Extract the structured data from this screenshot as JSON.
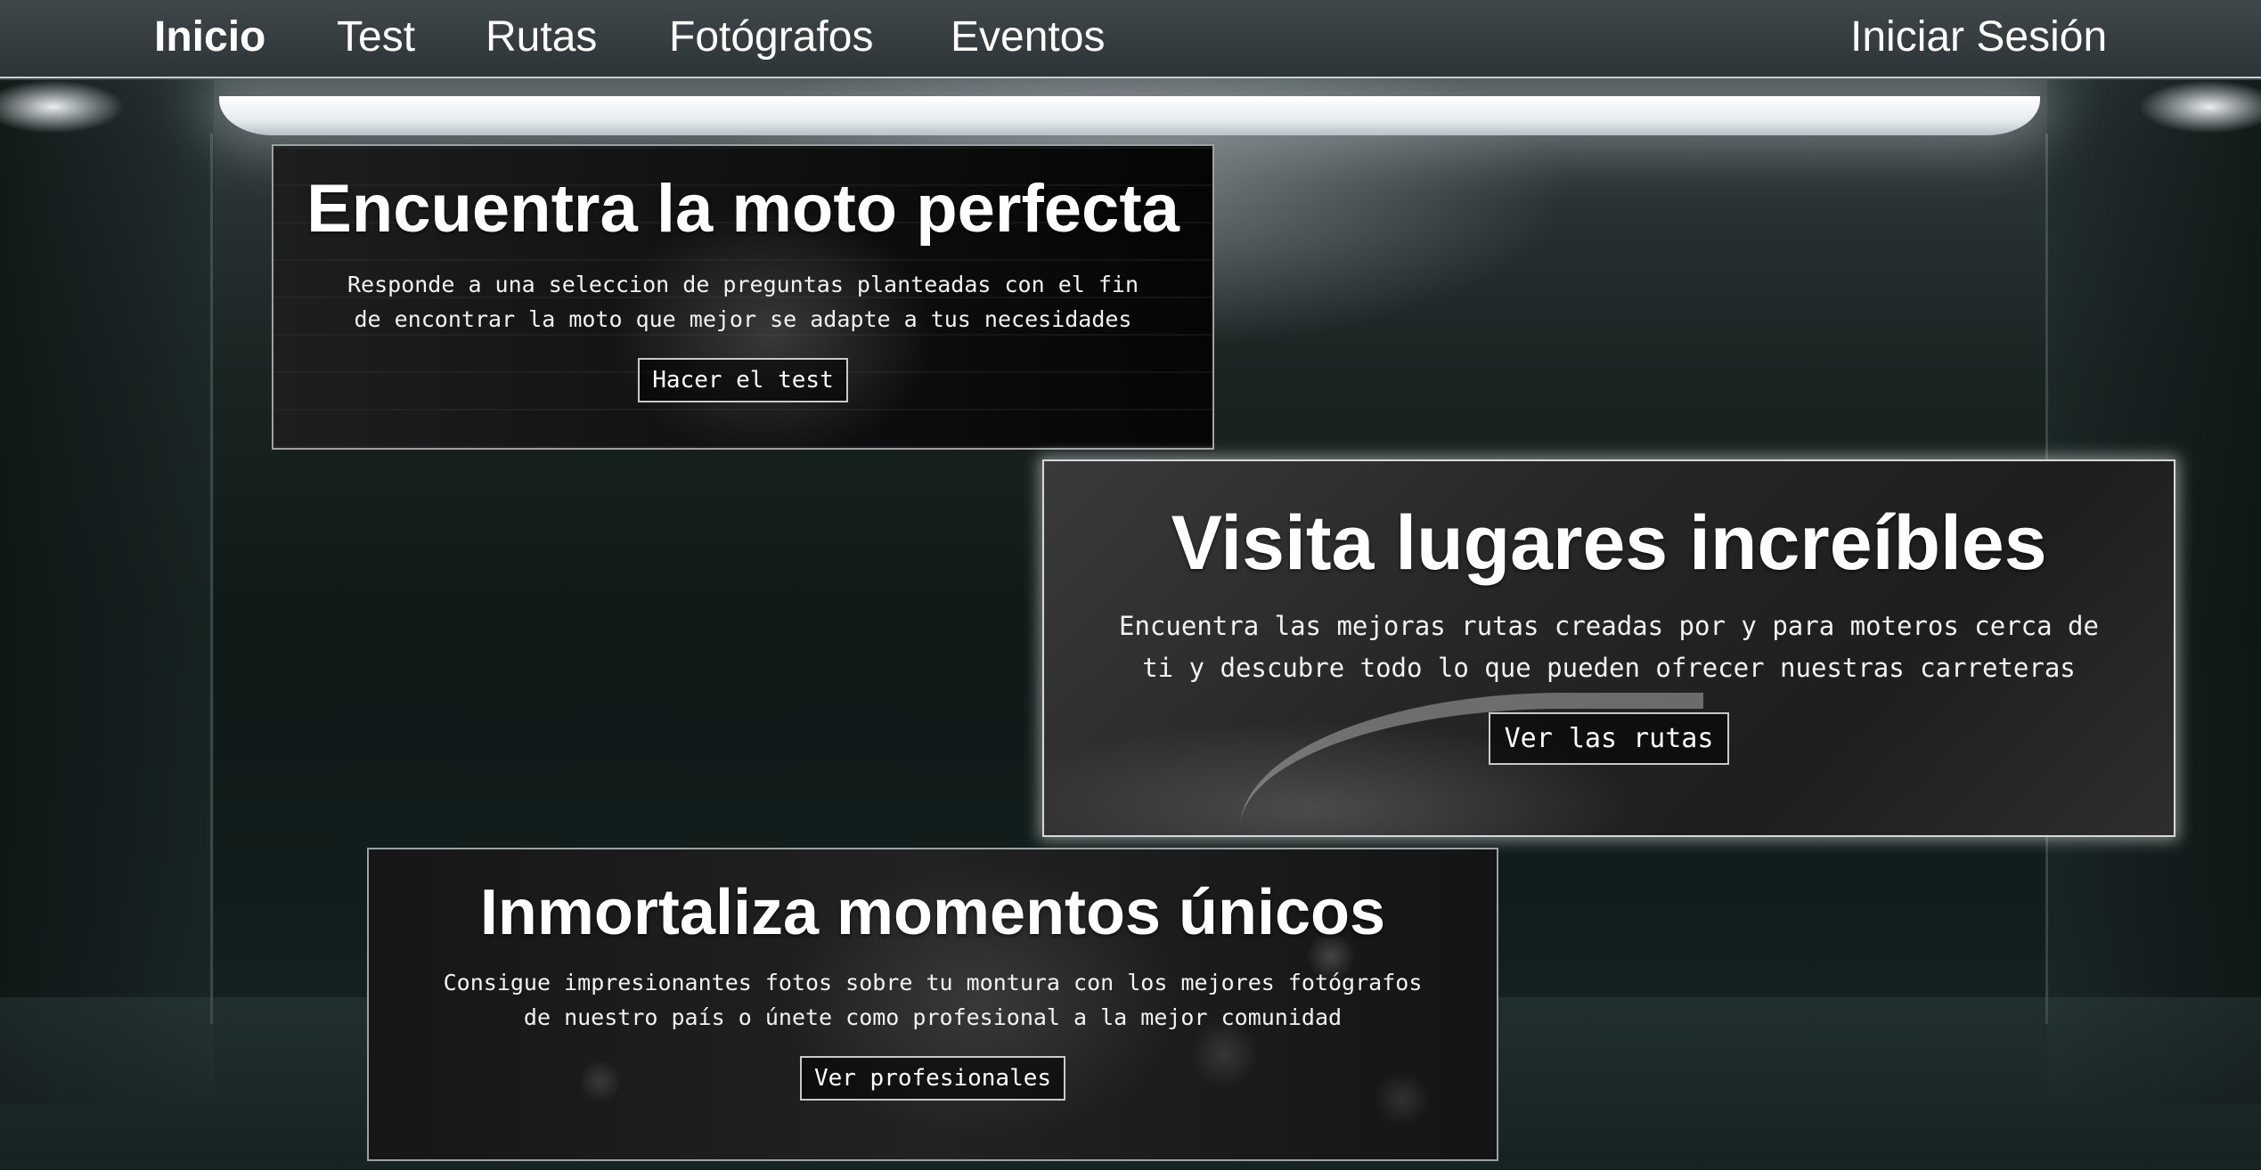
{
  "nav": {
    "items": [
      "Inicio",
      "Test",
      "Rutas",
      "Fotógrafos",
      "Eventos"
    ],
    "active": "Inicio",
    "login": "Iniciar Sesión"
  },
  "cards": {
    "test": {
      "title": "Encuentra la moto perfecta",
      "description": "Responde a una seleccion de preguntas planteadas con el fin de encontrar la moto que mejor se adapte a tus necesidades",
      "button": "Hacer el test"
    },
    "routes": {
      "title": "Visita lugares increíbles",
      "description": "Encuentra las mejoras rutas creadas por y para moteros cerca de ti y descubre todo lo que pueden ofrecer nuestras carreteras",
      "button": "Ver las rutas"
    },
    "photographers": {
      "title": "Inmortaliza momentos únicos",
      "description": "Consigue impresionantes fotos sobre tu montura con los mejores fotógrafos de nuestro país o únete como profesional a la mejor comunidad",
      "button": "Ver profesionales"
    }
  }
}
